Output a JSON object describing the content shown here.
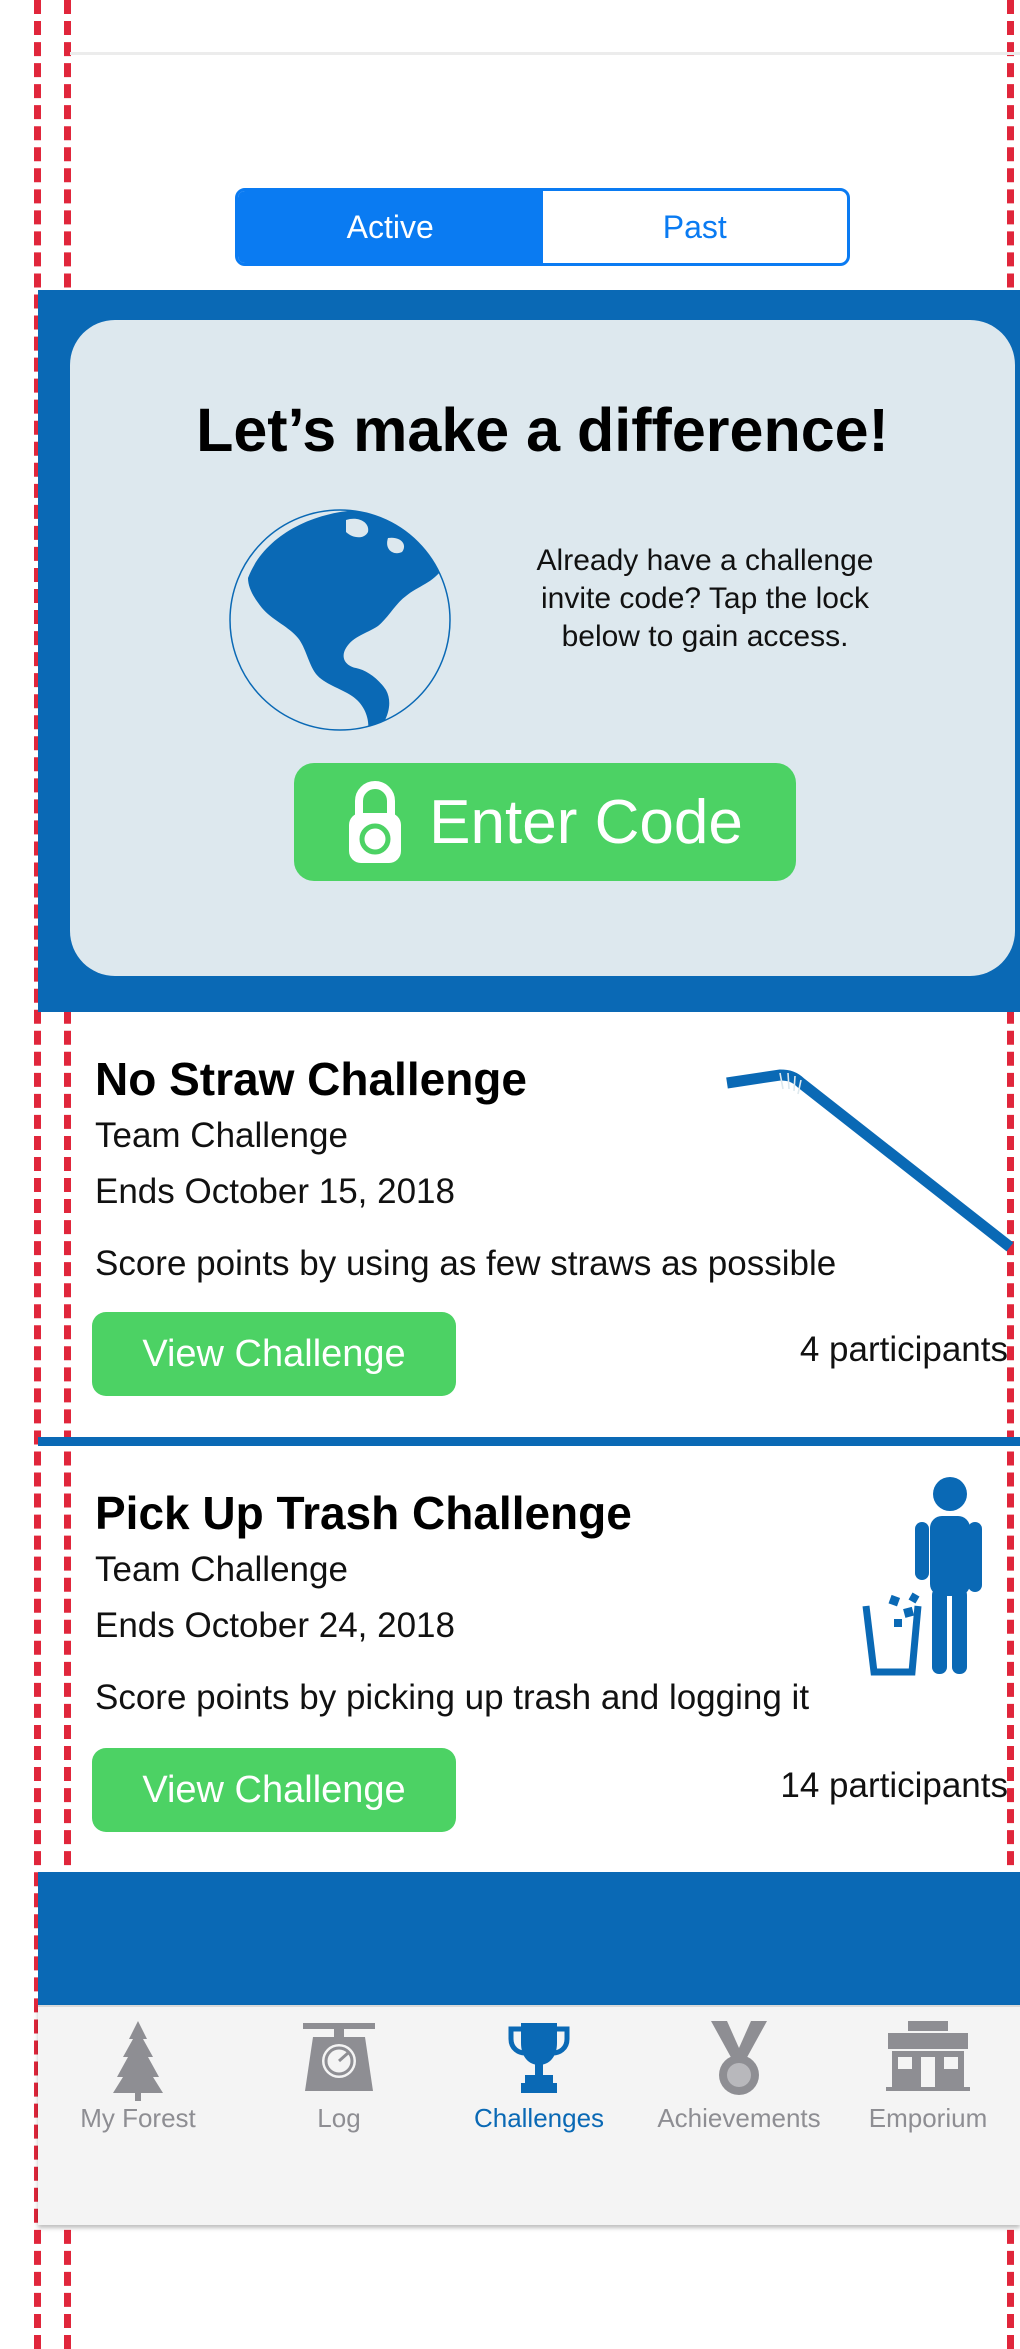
{
  "segmented": {
    "active": "Active",
    "past": "Past"
  },
  "hero": {
    "title": "Let’s make a difference!",
    "note": "Already have a challenge invite code? Tap the lock below to gain access.",
    "button": "Enter Code"
  },
  "challenges": [
    {
      "title": "No Straw Challenge",
      "type": "Team Challenge",
      "ends": "Ends October 15, 2018",
      "description": "Score points by using as few straws as possible",
      "button": "View Challenge",
      "participants": "4 participants",
      "icon": "straw-icon"
    },
    {
      "title": "Pick Up Trash Challenge",
      "type": "Team Challenge",
      "ends": "Ends October 24, 2018",
      "description": "Score points by picking up trash and logging it",
      "button": "View Challenge",
      "participants": "14 participants",
      "icon": "trash-person-icon"
    }
  ],
  "tabbar": {
    "items": [
      {
        "label": "My Forest",
        "icon": "tree-icon"
      },
      {
        "label": "Log",
        "icon": "scale-icon"
      },
      {
        "label": "Challenges",
        "icon": "trophy-icon",
        "active": true
      },
      {
        "label": "Achievements",
        "icon": "medal-icon"
      },
      {
        "label": "Emporium",
        "icon": "store-icon"
      }
    ]
  },
  "colors": {
    "primary_blue": "#0a69b5",
    "segment_blue": "#0a7bf2",
    "green": "#4cd264",
    "hero_card": "#dde8ee",
    "inactive_gray": "#8e8e93",
    "guide_red": "#e0263b"
  }
}
